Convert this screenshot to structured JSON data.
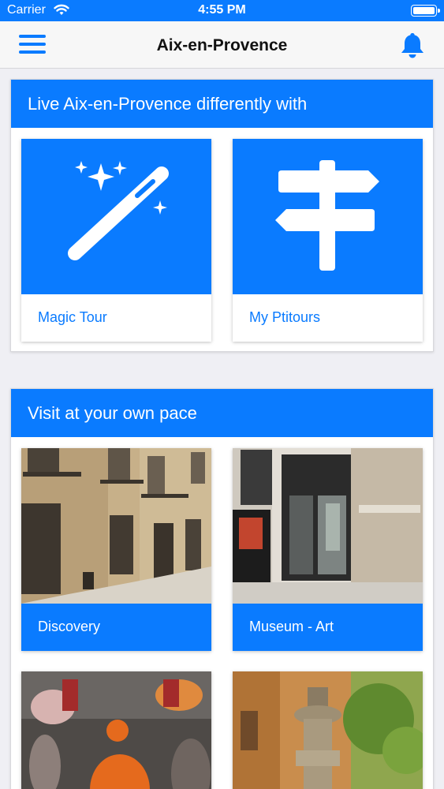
{
  "status_bar": {
    "carrier": "Carrier",
    "time": "4:55 PM"
  },
  "nav": {
    "title": "Aix-en-Provence",
    "menu_icon": "hamburger-menu-icon",
    "bell_icon": "bell-icon"
  },
  "section1": {
    "header": "Live Aix-en-Provence differently with",
    "tiles": [
      {
        "label": "Magic Tour",
        "icon": "magic-wand-icon"
      },
      {
        "label": "My Ptitours",
        "icon": "signpost-icon"
      }
    ]
  },
  "section2": {
    "header": "Visit at your own pace",
    "tiles": [
      {
        "label": "Discovery"
      },
      {
        "label": "Museum - Art"
      }
    ]
  },
  "colors": {
    "accent": "#0a7bff",
    "background": "#efeff4"
  }
}
